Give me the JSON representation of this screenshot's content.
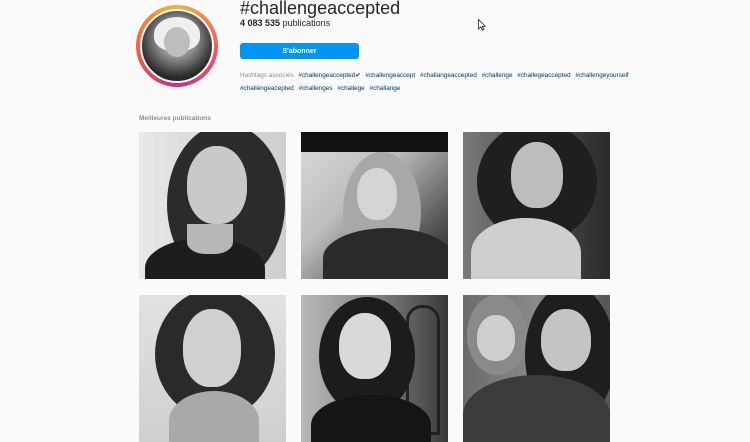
{
  "profile": {
    "hashtag": "#challengeaccepted",
    "post_count": "4 083 535",
    "post_label": "publications",
    "subscribe_label": "S'abonner",
    "avatar_icon": "avatar-icon"
  },
  "related": {
    "label": "Hashtags associés",
    "tags": [
      "#challengeaccepted✔",
      "#challengeaccept",
      "#challangeaccepted",
      "#challenge",
      "#challegeaccepted",
      "#challengeyourself",
      "#challengeacepted",
      "#challenges",
      "#challege",
      "#challange"
    ]
  },
  "top_posts": {
    "title": "Meilleures publications",
    "count": 6
  },
  "colors": {
    "accent": "#0095f6",
    "background": "#fafafa",
    "tag": "#00376b",
    "muted": "#8e8e8e"
  }
}
